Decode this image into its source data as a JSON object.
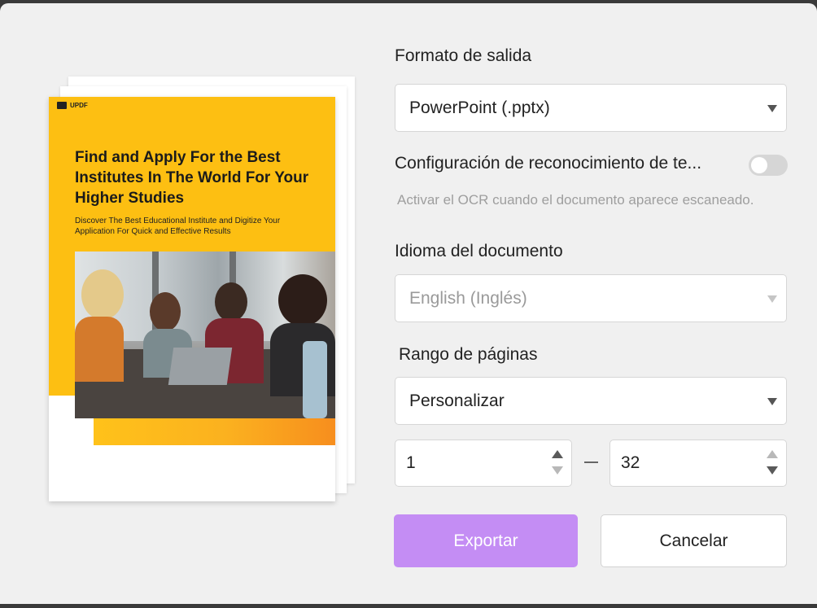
{
  "preview": {
    "logo_text": "UPDF",
    "title": "Find and Apply For the Best Institutes In The World For Your Higher Studies",
    "subtitle": "Discover The Best Educational Institute and Digitize Your Application For Quick and Effective Results"
  },
  "output_format": {
    "label": "Formato de salida",
    "value": "PowerPoint (.pptx)"
  },
  "ocr": {
    "label": "Configuración de reconocimiento de te...",
    "enabled": false,
    "hint": "Activar el OCR cuando el documento aparece escaneado."
  },
  "document_language": {
    "label": "Idioma del documento",
    "value": "English (Inglés)"
  },
  "page_range": {
    "label": "Rango de páginas",
    "value": "Personalizar",
    "from": "1",
    "to": "32"
  },
  "buttons": {
    "export": "Exportar",
    "cancel": "Cancelar"
  },
  "colors": {
    "accent": "#c48df4",
    "cover_yellow": "#fdbf12",
    "cover_orange": "#f78e1e"
  }
}
